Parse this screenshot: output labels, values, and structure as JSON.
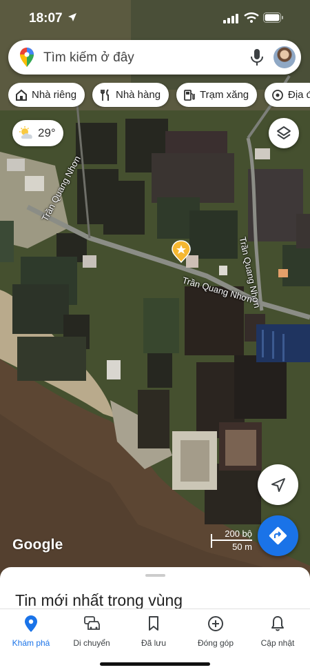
{
  "status_bar": {
    "time": "18:07",
    "icons": [
      "location-arrow-icon",
      "cellular-signal-icon",
      "wifi-icon",
      "battery-icon"
    ]
  },
  "search": {
    "placeholder": "Tìm kiếm ở đây",
    "icons": [
      "google-maps-pin-icon",
      "microphone-icon",
      "avatar"
    ]
  },
  "chips": [
    {
      "label": "Nhà riêng",
      "icon": "home-icon"
    },
    {
      "label": "Nhà hàng",
      "icon": "fork-knife-icon"
    },
    {
      "label": "Trạm xăng",
      "icon": "gas-station-icon"
    },
    {
      "label": "Địa đ",
      "icon": "landmark-icon"
    }
  ],
  "weather": {
    "temp": "29°",
    "icon": "partly-cloudy-icon"
  },
  "map": {
    "road_labels": [
      "Trần Quang Nhơn",
      "Trần Quang Nhơn",
      "Trần Quang Nhơn"
    ],
    "pin_icon": "starred-place-pin-icon",
    "attribution": "Google",
    "scale": {
      "imperial": "200 bộ",
      "metric": "50 m"
    }
  },
  "buttons": {
    "layers": "layers-icon",
    "my_location": "navigation-arrow-icon",
    "directions": "directions-icon"
  },
  "sheet": {
    "title": "Tin mới nhất trong vùng"
  },
  "nav": [
    {
      "label": "Khám phá",
      "icon": "explore-pin-icon",
      "active": true
    },
    {
      "label": "Di chuyển",
      "icon": "car-icon",
      "active": false
    },
    {
      "label": "Đã lưu",
      "icon": "bookmark-icon",
      "active": false
    },
    {
      "label": "Đóng góp",
      "icon": "add-circle-icon",
      "active": false
    },
    {
      "label": "Cập nhật",
      "icon": "bell-icon",
      "active": false
    }
  ],
  "colors": {
    "accent": "#1a73e8",
    "pin": "#f5b731"
  }
}
